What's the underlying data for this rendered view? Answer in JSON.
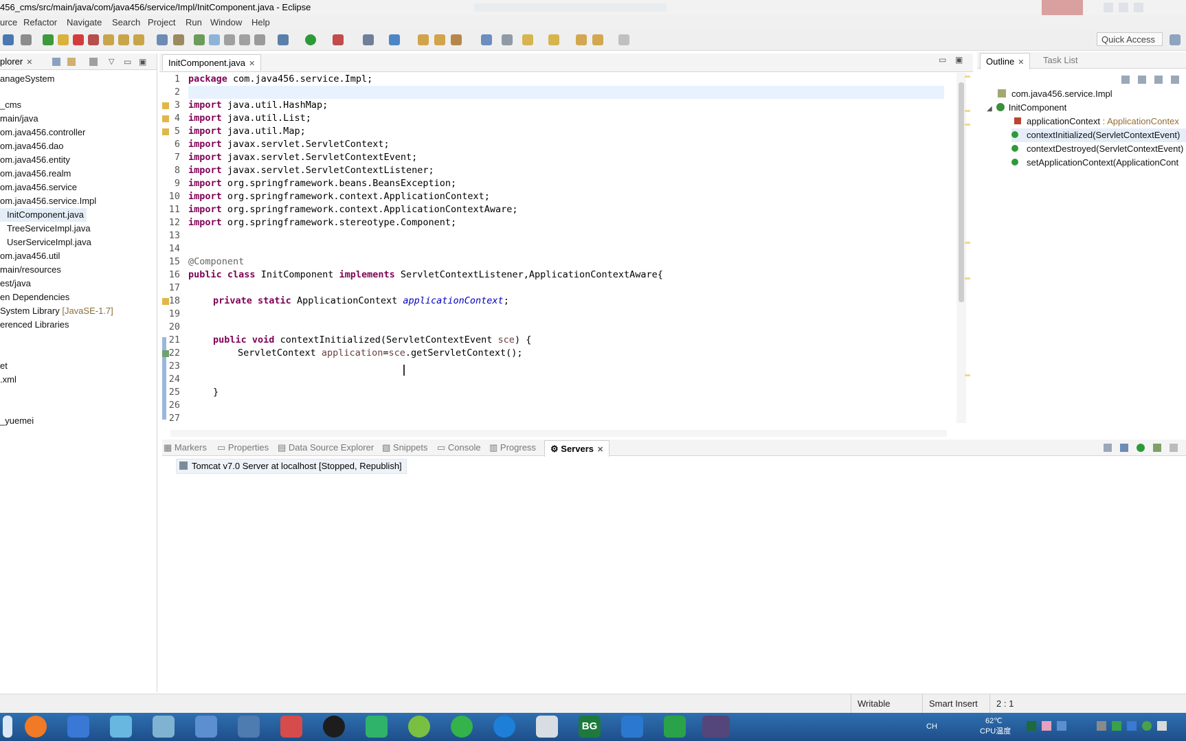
{
  "window": {
    "title": "456_cms/src/main/java/com/java456/service/Impl/InitComponent.java - Eclipse"
  },
  "menu": [
    "urce",
    "Refactor",
    "Navigate",
    "Search",
    "Project",
    "Run",
    "Window",
    "Help"
  ],
  "toolbar": {
    "quick_access": "Quick Access"
  },
  "explorer": {
    "tab_label": "plorer",
    "items": [
      "anageSystem",
      "_cms",
      "main/java",
      "om.java456.controller",
      "om.java456.dao",
      "om.java456.entity",
      "om.java456.realm",
      "om.java456.service",
      "om.java456.service.Impl",
      "InitComponent.java",
      "TreeServiceImpl.java",
      "UserServiceImpl.java",
      "om.java456.util",
      "main/resources",
      "est/java",
      "en Dependencies",
      "System Library",
      "erenced Libraries",
      "et",
      ".xml",
      "_yuemei"
    ],
    "system_library_suffix": "[JavaSE-1.7]"
  },
  "editor": {
    "tab_label": "InitComponent.java",
    "line_numbers": [
      "1",
      "2",
      "3",
      "4",
      "5",
      "6",
      "7",
      "8",
      "9",
      "10",
      "11",
      "12",
      "13",
      "14",
      "15",
      "16",
      "17",
      "18",
      "19",
      "20",
      "21",
      "22",
      "23",
      "24",
      "25",
      "26",
      "27"
    ],
    "lines": {
      "l1_kw": "package",
      "l1_rest": " com.java456.service.Impl;",
      "imp_kw": "import",
      "l3": " java.util.HashMap;",
      "l4": " java.util.List;",
      "l5": " java.util.Map;",
      "l6": " javax.servlet.ServletContext;",
      "l7": " javax.servlet.ServletContextEvent;",
      "l8": " javax.servlet.ServletContextListener;",
      "l9": " org.springframework.beans.BeansException;",
      "l10": " org.springframework.context.ApplicationContext;",
      "l11": " org.springframework.context.ApplicationContextAware;",
      "l12": " org.springframework.stereotype.Component;",
      "l15": "@Component",
      "l16_kw1": "public",
      "l16_kw2": "class",
      "l16_mid": " InitComponent ",
      "l16_kw3": "implements",
      "l16_rest": " ServletContextListener,ApplicationContextAware{",
      "l18_kw1": "private",
      "l18_kw2": "static",
      "l18_type": " ApplicationContext ",
      "l18_field": "applicationContext",
      "l18_end": ";",
      "l21_kw1": "public",
      "l21_kw2": "void",
      "l21_sig": " contextInitialized(ServletContextEvent ",
      "l21_param": "sce",
      "l21_end": ") {",
      "l22_type": "ServletContext ",
      "l22_var": "application",
      "l22_eq": "=",
      "l22_param": "sce",
      "l22_rest": ".getServletContext();",
      "l25": "}"
    }
  },
  "outline": {
    "tabs": [
      "Outline",
      "Task List"
    ],
    "items": [
      {
        "label": "com.java456.service.Impl"
      },
      {
        "label": "InitComponent"
      },
      {
        "label": "applicationContext",
        "suffix": " : ApplicationContex"
      },
      {
        "label": "contextInitialized(ServletContextEvent)"
      },
      {
        "label": "contextDestroyed(ServletContextEvent)"
      },
      {
        "label": "setApplicationContext(ApplicationCont"
      }
    ]
  },
  "bottom_panel": {
    "tabs": [
      "Markers",
      "Properties",
      "Data Source Explorer",
      "Snippets",
      "Console",
      "Progress",
      "Servers"
    ],
    "server_row": "Tomcat v7.0 Server at localhost  [Stopped, Republish]"
  },
  "status": {
    "writable": "Writable",
    "insert_mode": "Smart Insert",
    "position": "2 : 1"
  },
  "taskbar": {
    "ime": "CH",
    "temp": "62℃",
    "temp_label": "CPU温度",
    "app_bg": "BG"
  },
  "colors": {
    "keyword": "#7f0055",
    "field": "#0000c0",
    "annotation": "#646464",
    "taskbar": "#2f6fb0"
  }
}
